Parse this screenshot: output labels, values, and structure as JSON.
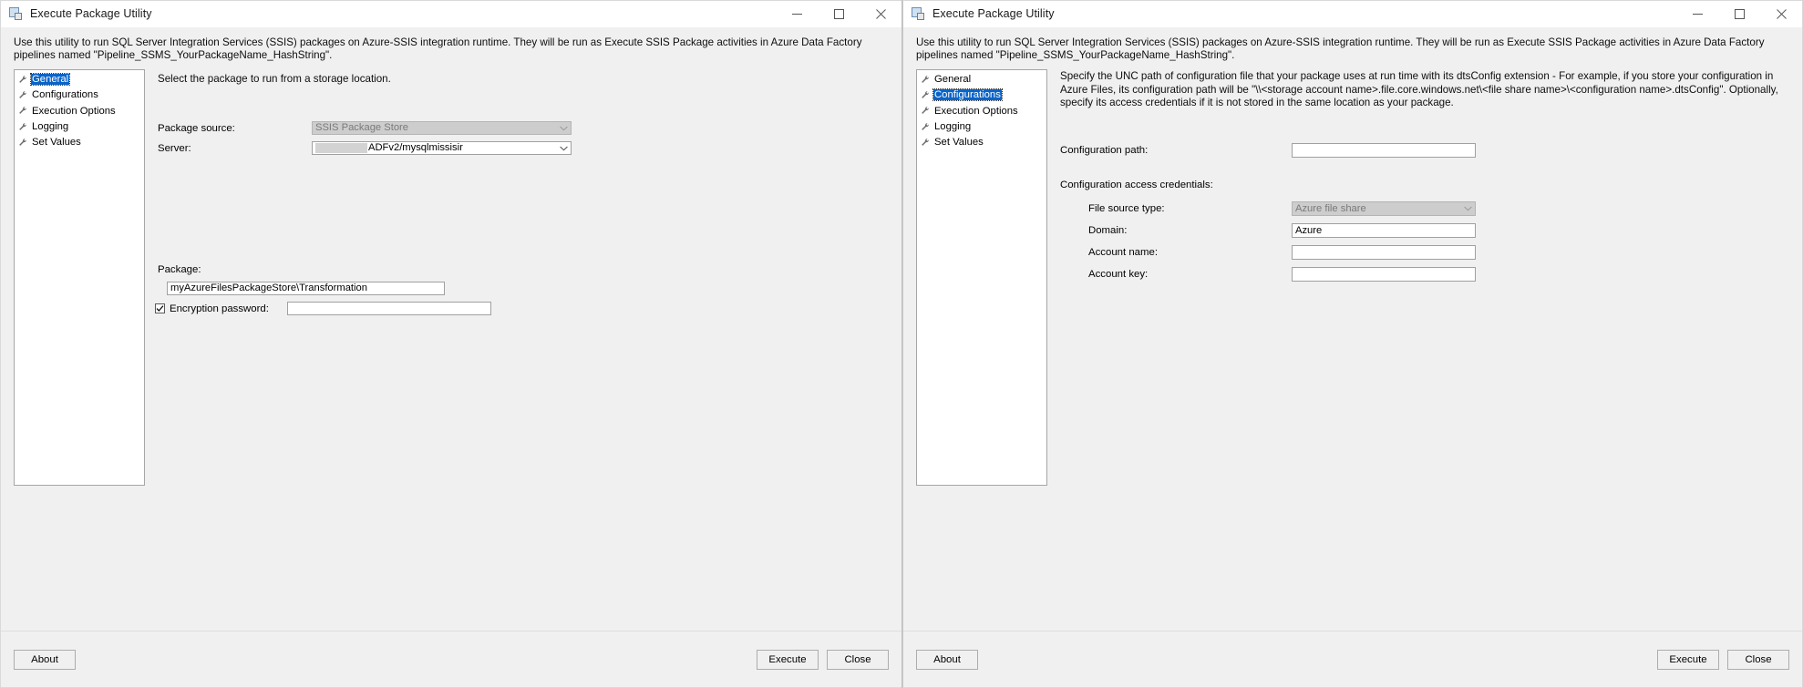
{
  "window_title": "Execute Package Utility",
  "title_icon": "package-utility-icon",
  "window_controls": {
    "minimize": "minimize-icon",
    "maximize": "maximize-icon",
    "close": "close-icon"
  },
  "description": "Use this utility to run SQL Server Integration Services (SSIS) packages on Azure-SSIS integration runtime. They will be run as Execute SSIS Package activities in Azure Data Factory pipelines named \"Pipeline_SSMS_YourPackageName_HashString\".",
  "tree": {
    "items": [
      {
        "label": "General",
        "selected": true
      },
      {
        "label": "Configurations",
        "selected": false
      },
      {
        "label": "Execution Options",
        "selected": false
      },
      {
        "label": "Logging",
        "selected": false
      },
      {
        "label": "Set Values",
        "selected": false
      }
    ]
  },
  "tree_right": {
    "items": [
      {
        "label": "General",
        "selected": false
      },
      {
        "label": "Configurations",
        "selected": true
      },
      {
        "label": "Execution Options",
        "selected": false
      },
      {
        "label": "Logging",
        "selected": false
      },
      {
        "label": "Set Values",
        "selected": false
      }
    ]
  },
  "left_pane": {
    "intro": "Select the package to run from a storage location.",
    "package_source_label": "Package source:",
    "package_source_value": "SSIS Package Store",
    "server_label": "Server:",
    "server_value": "ADFv2/mysqlmissisir",
    "server_redacted": true,
    "package_label": "Package:",
    "package_value": "myAzureFilesPackageStore\\Transformation",
    "encryption_label": "Encryption password:",
    "encryption_checked": true,
    "encryption_value": "",
    "encryption_placeholder": ""
  },
  "right_pane": {
    "intro": "Specify the UNC path of configuration file that your package uses at run time with its dtsConfig extension - For example, if you store your configuration in Azure Files, its configuration path will be \"\\\\<storage account name>.file.core.windows.net\\<file share name>\\<configuration name>.dtsConfig\".  Optionally, specify its access credentials if it is not stored in the same location as your package.",
    "configuration_path_label": "Configuration path:",
    "configuration_path_value": "",
    "credentials_label": "Configuration access credentials:",
    "file_source_type_label": "File source type:",
    "file_source_type_value": "Azure file share",
    "file_source_type_options": [
      "Azure file share"
    ],
    "domain_label": "Domain:",
    "domain_value": "Azure",
    "account_name_label": "Account name:",
    "account_name_value": "",
    "account_key_label": "Account key:",
    "account_key_value": ""
  },
  "footer": {
    "about_label": "About",
    "execute_label": "Execute",
    "close_label": "Close"
  },
  "colors": {
    "accent": "#0a64c8",
    "window_bg": "#f0f0f0",
    "field_bg": "#ffffff",
    "field_disabled_bg": "#cdcdcd",
    "border": "#a0a0a0"
  }
}
